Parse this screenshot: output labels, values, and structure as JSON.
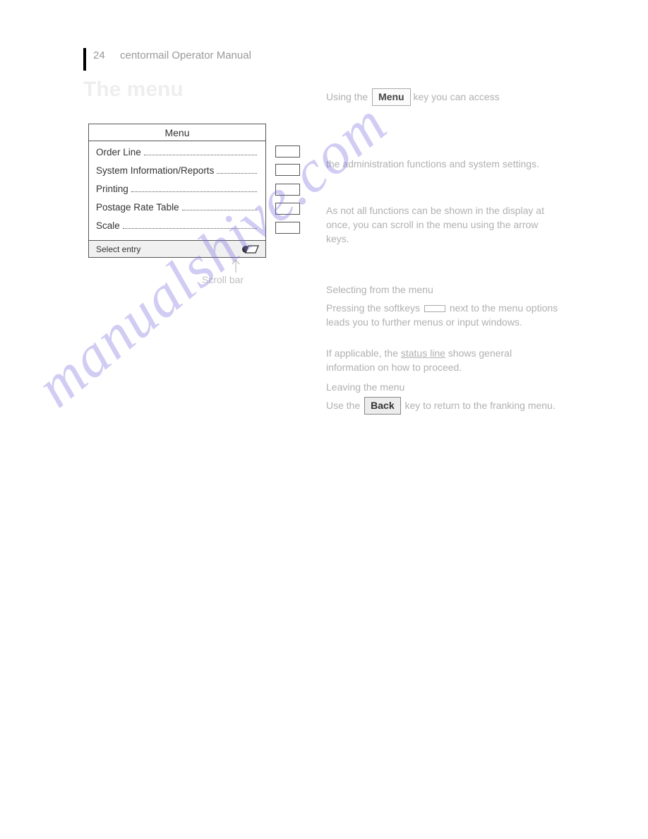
{
  "header": {
    "page_number": "24",
    "title": "centormail Operator Manual"
  },
  "section_heading": "The menu",
  "intro_text_pre": "Using the ",
  "menu_button_label": "Menu",
  "intro_text_post": " key you can access",
  "lcd": {
    "title": "Menu",
    "items": [
      "Order Line",
      "System Information/Reports",
      "Printing",
      "Postage Rate Table",
      "Scale"
    ],
    "footer_text": "Select entry"
  },
  "callout_label": "Scroll bar",
  "right_column": {
    "p1_pre": "the ",
    "p1_mid": "administration functions",
    "p1_post": " and ",
    "p1_tail": "system settings",
    "p1_end": ".",
    "p2": "As not all functions can be shown in the display at once, you can scroll in the menu using the arrow keys.",
    "p3": "Selecting from the menu",
    "p4": "Pressing the softkeys   next to the menu options leads you to further menus or input windows.",
    "p5_pre": "If applicable, the ",
    "p5_underlined": "status line",
    "p5_post": " shows general information on how to proceed.",
    "p6": "Leaving the menu",
    "p7_pre": "Use the ",
    "back_button_label": "Back",
    "p7_post": " key to return to the franking menu."
  },
  "watermark_text": "manualshive.com"
}
